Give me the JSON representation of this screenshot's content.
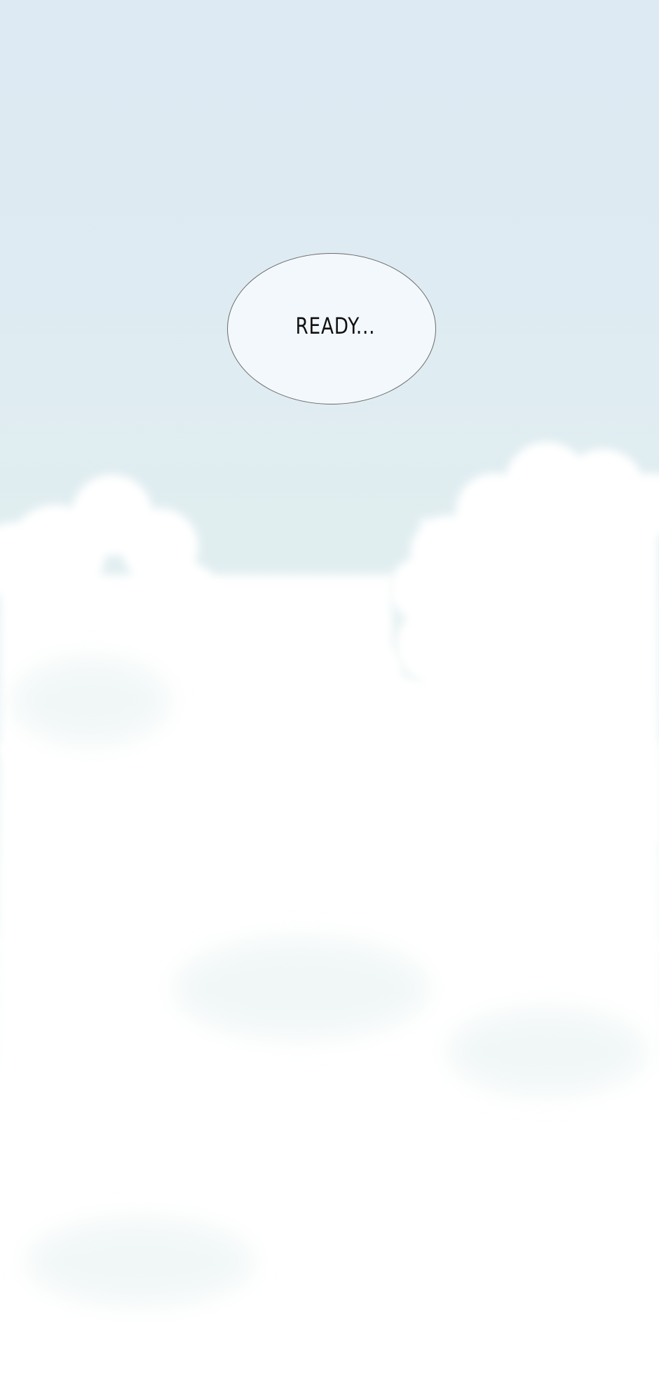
{
  "scene": {
    "sky_color": "#dde9f3",
    "cloud_color": "#ffffff",
    "bubble_fill": "#f3f8fc",
    "bubble_outline": "#6b6b6b"
  },
  "speech_bubble": {
    "text": "READY..."
  }
}
